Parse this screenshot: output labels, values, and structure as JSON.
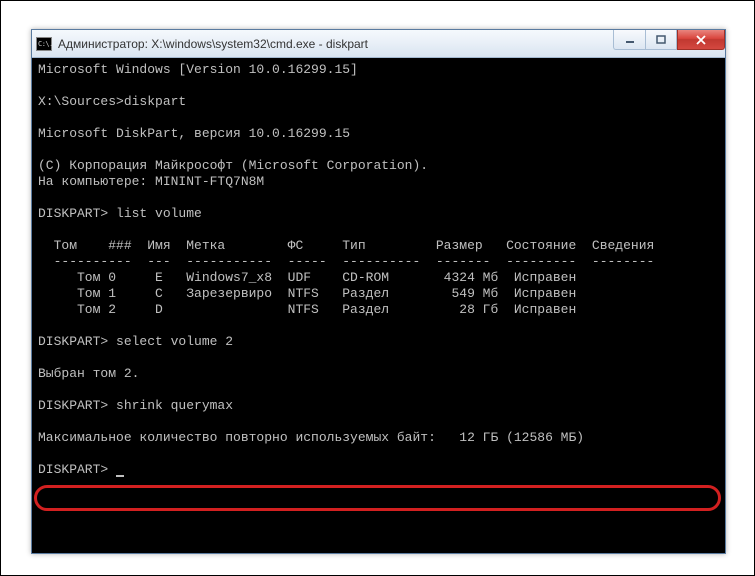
{
  "title": "Администратор: X:\\windows\\system32\\cmd.exe - diskpart",
  "icon_text": "C:\\.",
  "terminal": {
    "l1": "Microsoft Windows [Version 10.0.16299.15]",
    "l2": "",
    "l3": "X:\\Sources>diskpart",
    "l4": "",
    "l5": "Microsoft DiskPart, версия 10.0.16299.15",
    "l6": "",
    "l7": "(C) Корпорация Майкрософт (Microsoft Corporation).",
    "l8": "На компьютере: MININT-FTQ7N8M",
    "l9": "",
    "l10": "DISKPART> list volume",
    "l11": "",
    "l12": "  Том    ###  Имя  Метка        ФС     Тип         Размер   Состояние  Сведения",
    "l13": "  ----------  ---  -----------  -----  ----------  -------  ---------  --------",
    "l14": "     Том 0     E   Windows7_x8  UDF    CD-ROM       4324 Мб  Исправен",
    "l15": "     Том 1     C   Зарезервиро  NTFS   Раздел        549 Мб  Исправен",
    "l16": "     Том 2     D                NTFS   Раздел         28 Гб  Исправен",
    "l17": "",
    "l18": "DISKPART> select volume 2",
    "l19": "",
    "l20": "Выбран том 2.",
    "l21": "",
    "l22": "DISKPART> shrink querymax",
    "l23": "",
    "l24": "Максимальное количество повторно используемых байт:   12 ГБ (12586 МБ)",
    "l25": "",
    "l26": "DISKPART> "
  }
}
